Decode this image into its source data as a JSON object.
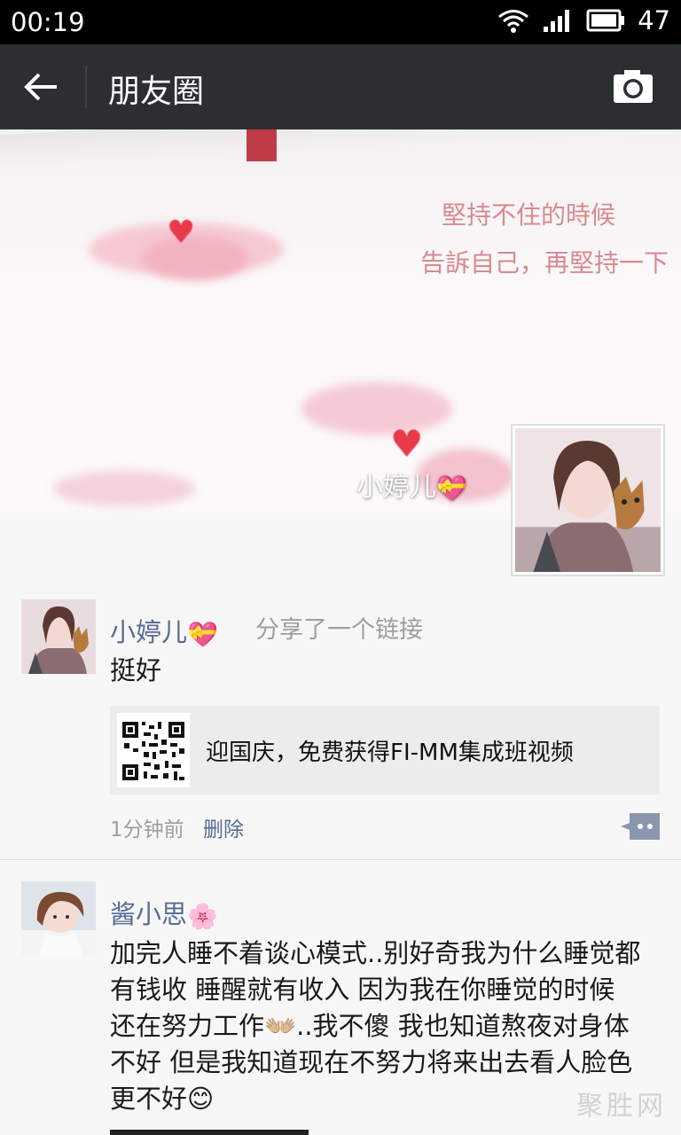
{
  "status_bar": {
    "time": "00:19",
    "battery": "47"
  },
  "title_bar": {
    "title": "朋友圈"
  },
  "cover": {
    "quote_line1": "堅持不住的時候",
    "quote_line2": "告訴自己，再堅持一下",
    "profile_name": "小婷儿",
    "profile_emoji": "💝"
  },
  "posts": [
    {
      "author": "小婷儿",
      "author_emoji": "💝",
      "action": "分享了一个链接",
      "text": "挺好",
      "link_title": "迎国庆，免费获得FI-MM集成班视频",
      "time": "1分钟前",
      "delete_label": "删除"
    },
    {
      "author": "酱小思",
      "author_emoji": "🌸",
      "lines": [
        "加完人睡不着谈心模式..别好奇我为什么睡觉都",
        "有钱收  睡醒就有收入  因为我在你睡觉的时候",
        "还在努力工作👐🏼..我不傻  我也知道熬夜对身体",
        "不好  但是我知道现在不努力将来出去看人脸色",
        "更不好😊"
      ]
    }
  ],
  "watermark": "聚胜网"
}
